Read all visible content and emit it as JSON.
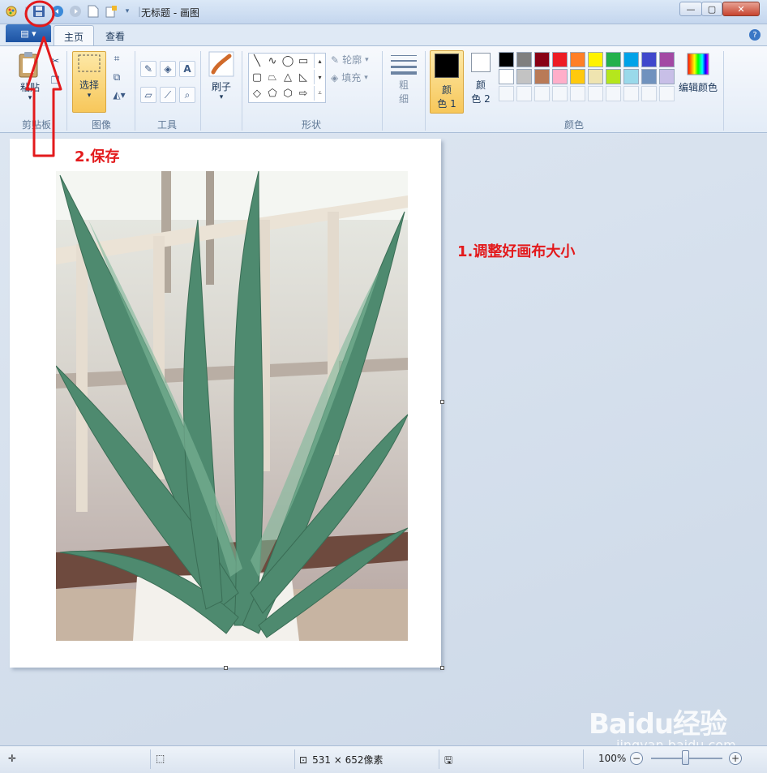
{
  "window": {
    "title": "无标题 - 画图",
    "minimize_label": "—",
    "maximize_label": "▢",
    "close_label": "✕"
  },
  "tabs": {
    "app_menu_label": "▤ ▾",
    "home": "主页",
    "view": "查看",
    "help_label": "?"
  },
  "ribbon": {
    "clipboard": {
      "paste": "粘贴",
      "group": "剪贴板"
    },
    "image": {
      "select": "选择",
      "group": "图像"
    },
    "tools": {
      "group": "工具"
    },
    "brush": {
      "label": "刷子"
    },
    "shapes": {
      "outline": "轮廓",
      "fill": "填充",
      "group": "形状"
    },
    "size": {
      "label_line1": "粗",
      "label_line2": "细"
    },
    "colors": {
      "color1_line1": "颜",
      "color1_line2": "色 1",
      "color2_line1": "颜",
      "color2_line2": "色 2",
      "edit": "编辑颜色",
      "group": "颜色",
      "color1_value": "#000000",
      "color2_value": "#ffffff",
      "palette_row1": [
        "#000000",
        "#7f7f7f",
        "#880015",
        "#ed1c24",
        "#ff7f27",
        "#fff200",
        "#22b14c",
        "#00a2e8",
        "#3f48cc",
        "#a349a4"
      ],
      "palette_row2": [
        "#ffffff",
        "#c3c3c3",
        "#b97a57",
        "#ffaec9",
        "#ffc90e",
        "#efe4b0",
        "#b5e61d",
        "#99d9ea",
        "#7092be",
        "#c8bfe7"
      ]
    }
  },
  "annotations": {
    "step1": "1.调整好画布大小",
    "step2": "2.保存"
  },
  "statusbar": {
    "canvas_size": "531 × 652像素",
    "zoom": "100%"
  },
  "watermark": {
    "brand": "Baidu经验",
    "url": "jingyan.baidu.com"
  }
}
